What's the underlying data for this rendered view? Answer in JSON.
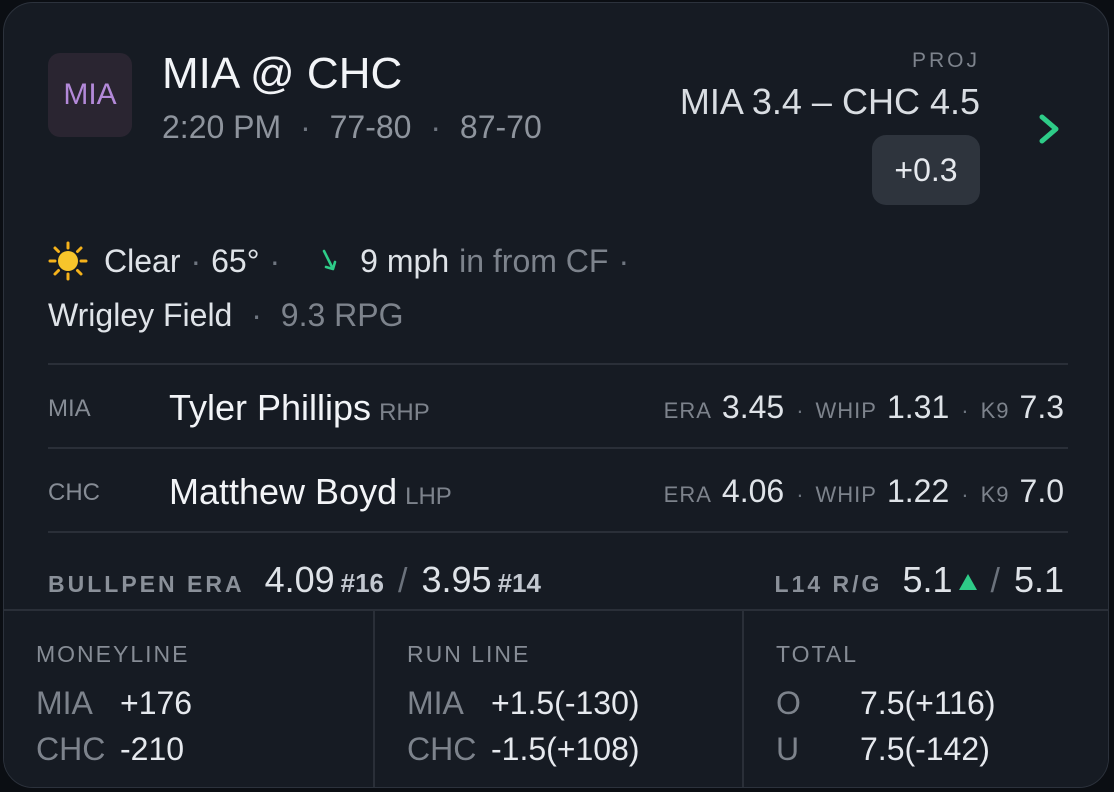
{
  "header": {
    "logo_text": "MIA",
    "matchup": "MIA @ CHC",
    "time": "2:20 PM",
    "away_record": "77-80",
    "home_record": "87-70",
    "separator": "·",
    "proj_label": "PROJ",
    "proj_value": "MIA 3.4 – CHC 4.5",
    "edge": "+0.3"
  },
  "weather": {
    "icon": "sun-icon",
    "condition": "Clear",
    "temp": "65°",
    "wind_icon": "wind-arrow-down-icon",
    "wind_speed": "9 mph",
    "wind_dir": "in from CF",
    "venue": "Wrigley Field",
    "rpg": "9.3 RPG"
  },
  "pitchers": [
    {
      "team": "MIA",
      "name": "Tyler Phillips",
      "hand": "RHP",
      "era_label": "ERA",
      "era": "3.45",
      "whip_label": "WHIP",
      "whip": "1.31",
      "k9_label": "K9",
      "k9": "7.3"
    },
    {
      "team": "CHC",
      "name": "Matthew Boyd",
      "hand": "LHP",
      "era_label": "ERA",
      "era": "4.06",
      "whip_label": "WHIP",
      "whip": "1.22",
      "k9_label": "K9",
      "k9": "7.0"
    }
  ],
  "bullpen": {
    "label": "BULLPEN ERA",
    "away_era": "4.09",
    "away_rank": "#16",
    "home_era": "3.95",
    "home_rank": "#14",
    "slash": "/"
  },
  "l14": {
    "label": "L14 R/G",
    "away": "5.1",
    "home": "5.1",
    "trend": "up"
  },
  "markets": {
    "moneyline": {
      "title": "MONEYLINE",
      "rows": [
        {
          "team": "MIA",
          "value": "+176"
        },
        {
          "team": "CHC",
          "value": "-210"
        }
      ]
    },
    "run_line": {
      "title": "RUN LINE",
      "rows": [
        {
          "team": "MIA",
          "value": "+1.5(-130)"
        },
        {
          "team": "CHC",
          "value": "-1.5(+108)"
        }
      ]
    },
    "total": {
      "title": "TOTAL",
      "rows": [
        {
          "team": "O",
          "value": "7.5(+116)"
        },
        {
          "team": "U",
          "value": "7.5(-142)"
        }
      ]
    }
  },
  "colors": {
    "accent": "#2ecc88",
    "logo_text": "#b389d9",
    "card_bg": "#161b23"
  }
}
